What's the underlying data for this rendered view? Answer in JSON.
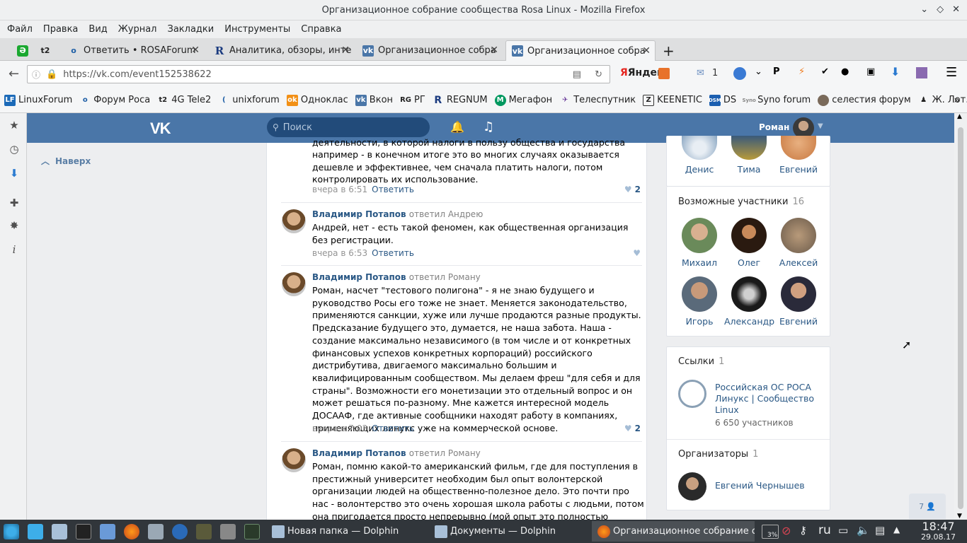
{
  "window": {
    "title": "Организационное собрание сообщества Rosa Linux - Mozilla Firefox"
  },
  "menu": [
    "Файл",
    "Правка",
    "Вид",
    "Журнал",
    "Закладки",
    "Инструменты",
    "Справка"
  ],
  "tabs": [
    {
      "label": "Ответить • ROSAForum"
    },
    {
      "label": "Аналитика, обзоры, инте"
    },
    {
      "label": "Организационное собра"
    },
    {
      "label": "Организационное собра"
    }
  ],
  "nav": {
    "url": "https://vk.com/event152538622",
    "search_engine": "Яндекс",
    "mail_count": "1"
  },
  "bookmarks": [
    "LinuxForum",
    "Форум Роса",
    "4G Tele2",
    "unixforum",
    "Одноклас",
    "Вкон",
    "РГ",
    "REGNUM",
    "Мегафон",
    "Телеспутник",
    "KEENETIC",
    "DS",
    "Syno forum",
    "селестия форум",
    "Ж. Лот."
  ],
  "vk": {
    "search_placeholder": "Поиск",
    "user_name": "Роман",
    "scroll_up": "Наверх"
  },
  "comments": [
    {
      "text": "например - в конечном итоге это во многих случаях оказывается дешевле и эффективнее, чем сначала платить налоги, потом контролировать их использование.",
      "time": "вчера в 6:51",
      "reply_label": "Ответить",
      "likes": "2"
    },
    {
      "author": "Владимир Потапов",
      "reply_to": "ответил Андрею",
      "text": "Андрей, нет - есть такой феномен, как общественная организация без регистрации.",
      "time": "вчера в 6:53",
      "reply_label": "Ответить",
      "likes": ""
    },
    {
      "author": "Владимир Потапов",
      "reply_to": "ответил Роману",
      "text": "Роман, насчет \"тестового полигона\" - я не знаю будущего и руководство Росы его тоже не знает. Меняется законодательство, применяются санкции, хуже или лучше продаются разные продукты. Предсказание будущего это, думается, не наша забота. Наша - создание максимально независимого (в том числе и от конкретных финансовых успехов конкретных корпораций) российского дистрибутива, двигаемого максимально большим и квалифицированным сообществом. Мы делаем фреш \"для себя и для страны\". Возможности его монетизации это отдельный вопрос и он может решаться по-разному. Мне кажется интересной модель ДОСААФ, где активные сообщники находят работу в компаниях, применяющих линукс уже на коммерческой основе.",
      "time": "вчера в 7:03",
      "reply_label": "Ответить",
      "likes": "2"
    },
    {
      "author": "Владимир Потапов",
      "reply_to": "ответил Роману",
      "text": "Роман, помню какой-то американский фильм, где для поступления в престижный университет необходим был опыт волонтерской организации людей на общественно-полезное дело. Это почти про нас - волонтерство это очень хорошая школа работы с людьми, потом она пригодается просто непрерывно (мой опыт это полностью подтверждает - волонтерил"
    }
  ],
  "participants_top": [
    "Денис",
    "Тима",
    "Евгений"
  ],
  "possible": {
    "title": "Возможные участники",
    "count": "16",
    "people": [
      "Михаил",
      "Олег",
      "Алексей",
      "Игорь",
      "Александр",
      "Евгений"
    ]
  },
  "links": {
    "title": "Ссылки",
    "count": "1",
    "name": "Российская ОС РОСА Линукс | Сообщество Linux",
    "members": "6 650 участников"
  },
  "organizers": {
    "title": "Организаторы",
    "count": "1",
    "name": "Евгений Чернышев"
  },
  "online_badge": "7",
  "taskbar": {
    "tasks": [
      "Новая папка — Dolphin",
      "Документы — Dolphin",
      "Организационное собрание с..."
    ],
    "battery": "3%",
    "lang": "ru",
    "time": "18:47",
    "date": "29.08.17"
  }
}
